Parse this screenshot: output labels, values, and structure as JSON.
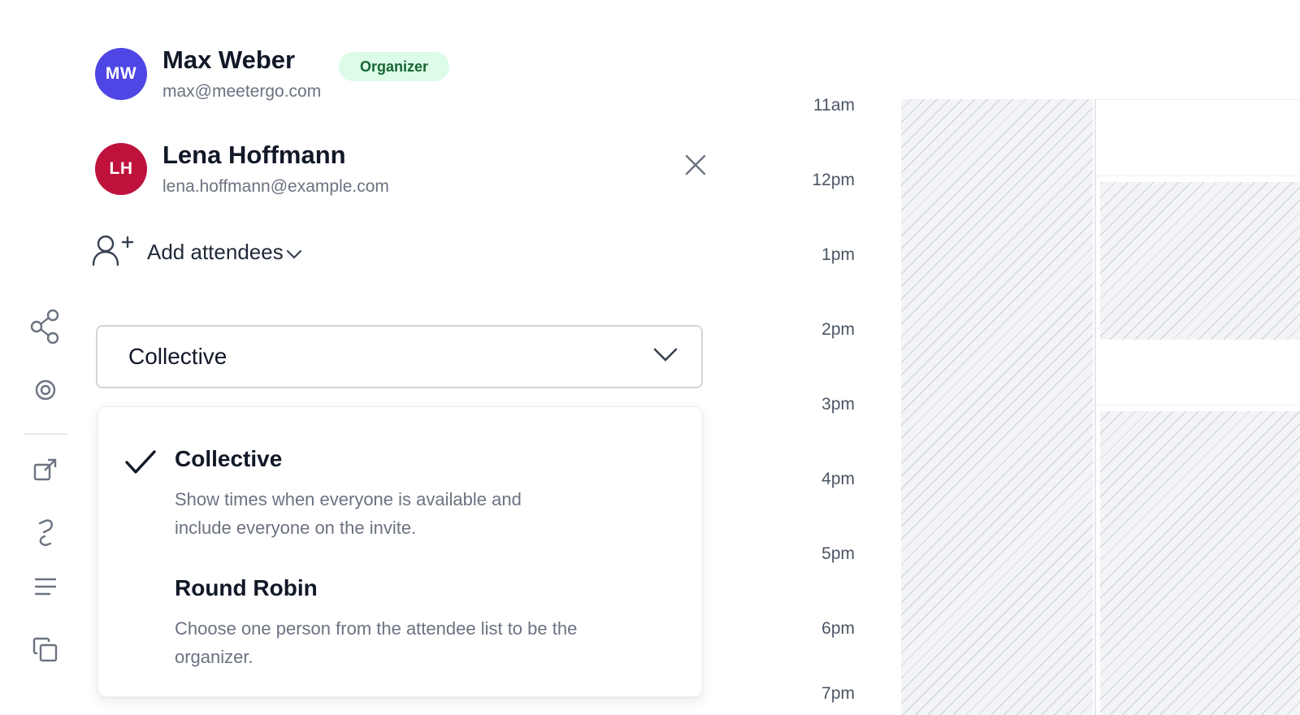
{
  "attendees": [
    {
      "initials": "MW",
      "name": "Max Weber",
      "email": "max@meetergo.com",
      "badge": "Organizer",
      "color": "#4f46e5"
    },
    {
      "initials": "LH",
      "name": "Lena Hoffmann",
      "email": "lena.hoffmann@example.com",
      "color": "#be123c"
    }
  ],
  "add_attendees": {
    "label": "Add attendees"
  },
  "scheduling_select": {
    "value": "Collective"
  },
  "scheduling_options": [
    {
      "title": "Collective",
      "description": "Show times when everyone is available and include everyone on the invite.",
      "selected": true
    },
    {
      "title": "Round Robin",
      "description": "Choose one person from the attendee list to be the organizer.",
      "selected": false
    }
  ],
  "calendar": {
    "hours": [
      "11am",
      "12pm",
      "1pm",
      "2pm",
      "3pm",
      "4pm",
      "5pm",
      "6pm",
      "7pm"
    ]
  },
  "sidebar_icons": [
    "share-icon",
    "target-icon",
    "external-link-icon",
    "redirect-icon",
    "menu-lines-icon",
    "copy-icon"
  ]
}
